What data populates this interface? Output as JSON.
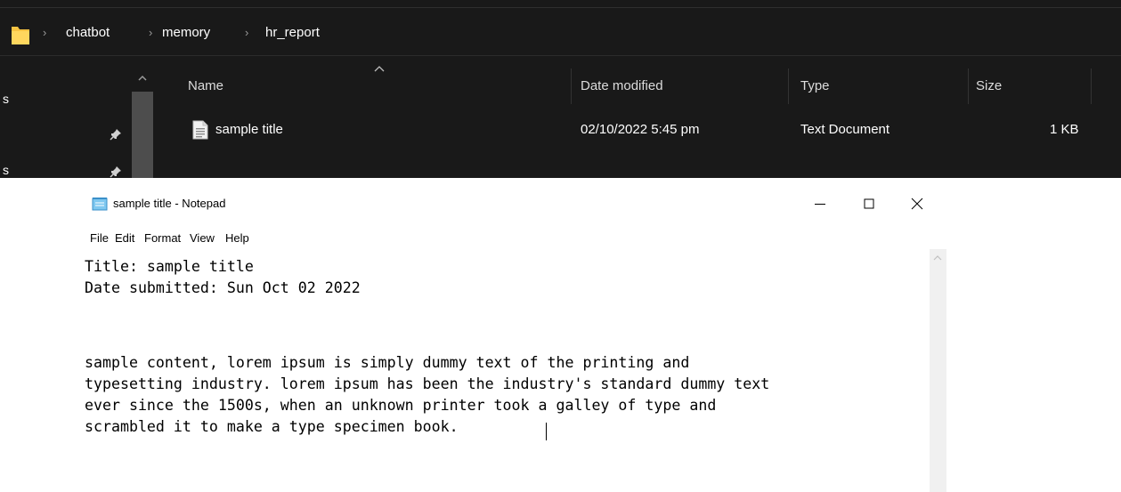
{
  "explorer": {
    "breadcrumbs": [
      "chatbot",
      "memory",
      "hr_report"
    ],
    "nav_items": [
      "s",
      "s"
    ],
    "columns": {
      "name": "Name",
      "date_modified": "Date modified",
      "type": "Type",
      "size": "Size"
    },
    "files": [
      {
        "name": "sample title",
        "date_modified": "02/10/2022 5:45 pm",
        "type": "Text Document",
        "size": "1 KB"
      }
    ]
  },
  "notepad": {
    "title": "sample title - Notepad",
    "menu": [
      "File",
      "Edit",
      "Format",
      "View",
      "Help"
    ],
    "lines": [
      "Title: sample title",
      "Date submitted: Sun Oct 02 2022",
      "",
      "",
      "sample content, lorem ipsum is simply dummy text of the printing and",
      "typesetting industry. lorem ipsum has been the industry's standard dummy text",
      "ever since the 1500s, when an unknown printer took a galley of type and",
      "scrambled it to make a type specimen book. "
    ]
  },
  "icons": {
    "folder": "folder-icon",
    "pin": "pin-icon",
    "document": "text-document-icon",
    "notepad": "notepad-icon",
    "minimize": "minimize-icon",
    "maximize": "maximize-icon",
    "close": "close-icon"
  },
  "colors": {
    "explorer_bg": "#191919",
    "folder": "#f6c342",
    "notepad_bg": "#ffffff"
  }
}
